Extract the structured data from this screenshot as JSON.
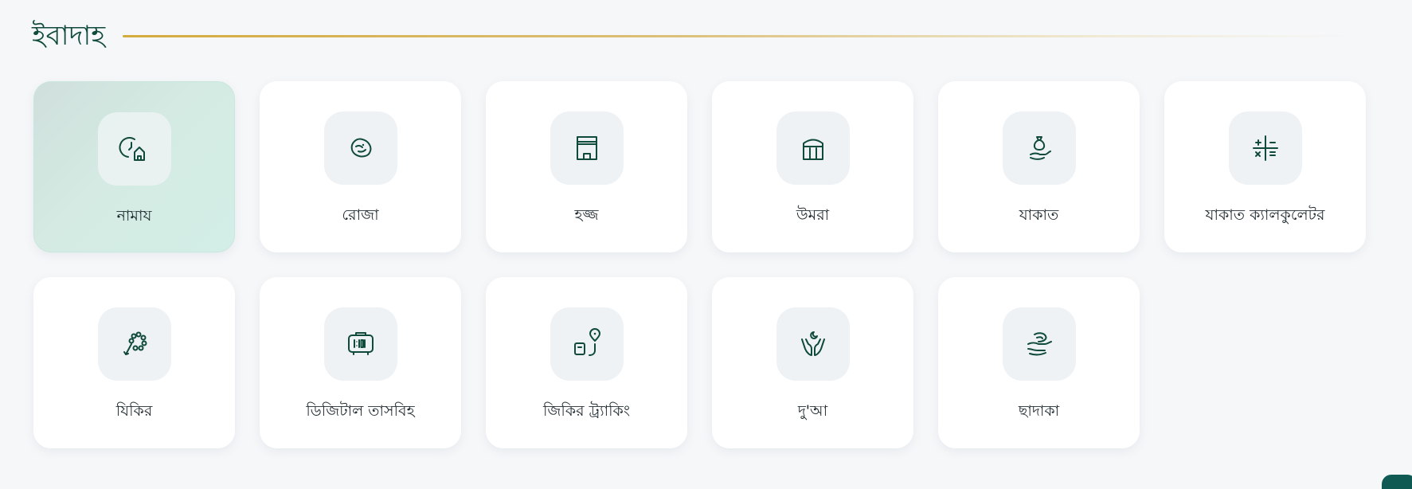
{
  "section": {
    "title": "ইবাদাহ"
  },
  "items": [
    {
      "label": "নামায",
      "icon": "prayer-clock-mosque-icon",
      "active": true
    },
    {
      "label": "রোজা",
      "icon": "date-fruit-icon"
    },
    {
      "label": "হজ্জ",
      "icon": "kaaba-icon"
    },
    {
      "label": "উমরা",
      "icon": "kaaba-dome-icon"
    },
    {
      "label": "যাকাত",
      "icon": "hand-money-bag-icon"
    },
    {
      "label": "যাকাত ক্যালকুলেটর",
      "icon": "calculator-icon"
    },
    {
      "label": "যিকির",
      "icon": "tasbih-beads-icon"
    },
    {
      "label": "ডিজিটাল তাসবিহ",
      "icon": "digital-counter-icon"
    },
    {
      "label": "জিকির ট্র্যাকিং",
      "icon": "tracking-pin-icon"
    },
    {
      "label": "দু'আ",
      "icon": "praying-hands-icon"
    },
    {
      "label": "ছাদাকা",
      "icon": "charity-hand-icon"
    }
  ],
  "colors": {
    "accent": "#0f4a3a",
    "gold": "#d4ab3e",
    "active_bg": "#d2eae3"
  }
}
